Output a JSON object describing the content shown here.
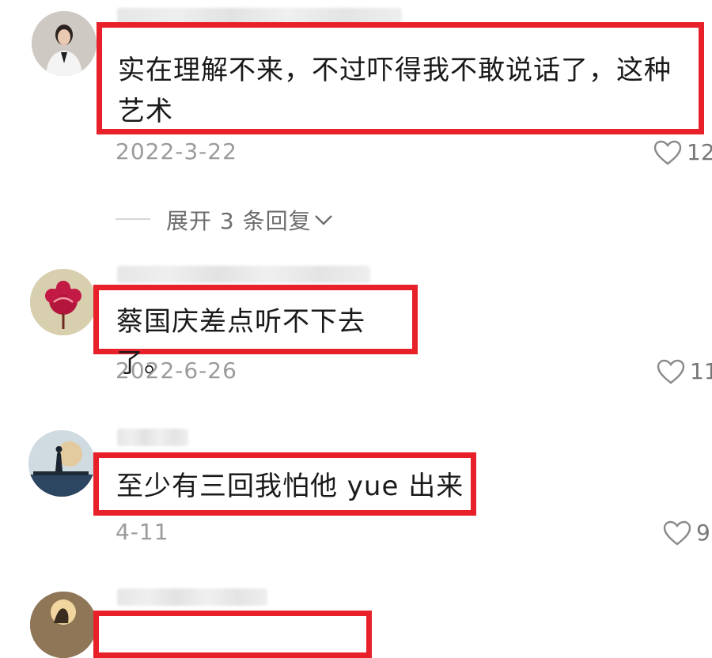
{
  "comments": [
    {
      "text": "实在理解不来，不过吓得我不敢说话了，这种艺术",
      "line1": "实在理解不来，不过吓得我不敢说话了，这种",
      "line2": "艺术",
      "date": "2022-3-22",
      "likes": "12",
      "avatar": "woman-in-white-avatar"
    },
    {
      "text": "蔡国庆差点听不下去了。",
      "date": "2022-6-26",
      "likes": "11",
      "avatar": "red-flower-avatar"
    },
    {
      "text": "至少有三回我怕他 yue 出来",
      "date": "4-11",
      "likes": "9",
      "avatar": "silhouette-landscape-avatar"
    }
  ],
  "expand_replies": {
    "label": "展开 3 条回复",
    "icon": "chevron-down-icon"
  },
  "colors": {
    "highlight": "#e8202a",
    "date": "#9b9b9b",
    "text": "#1a1a1a"
  }
}
